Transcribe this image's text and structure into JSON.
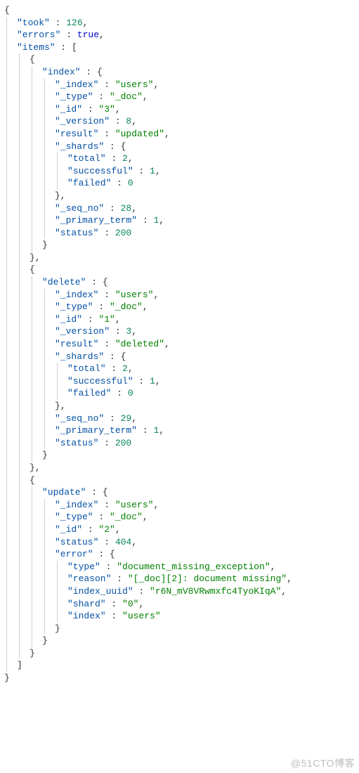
{
  "watermark": "@51CTO博客",
  "response": {
    "took": 126,
    "errors": true,
    "items": [
      {
        "index": {
          "_index": "users",
          "_type": "_doc",
          "_id": "3",
          "_version": 8,
          "result": "updated",
          "_shards": {
            "total": 2,
            "successful": 1,
            "failed": 0
          },
          "_seq_no": 28,
          "_primary_term": 1,
          "status": 200
        }
      },
      {
        "delete": {
          "_index": "users",
          "_type": "_doc",
          "_id": "1",
          "_version": 3,
          "result": "deleted",
          "_shards": {
            "total": 2,
            "successful": 1,
            "failed": 0
          },
          "_seq_no": 29,
          "_primary_term": 1,
          "status": 200
        }
      },
      {
        "update": {
          "_index": "users",
          "_type": "_doc",
          "_id": "2",
          "status": 404,
          "error": {
            "type": "document_missing_exception",
            "reason": "[_doc][2]: document missing",
            "index_uuid": "r6N_mV8VRwmxfc4TyoKIqA",
            "shard": "0",
            "index": "users"
          }
        }
      }
    ]
  }
}
